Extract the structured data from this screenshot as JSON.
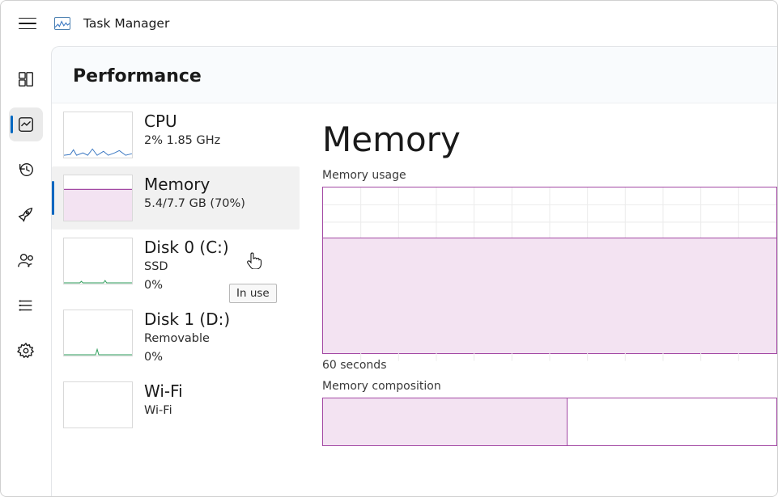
{
  "app": {
    "title": "Task Manager"
  },
  "page": {
    "title": "Performance"
  },
  "categories": {
    "cpu": {
      "title": "CPU",
      "sub1": "2%  1.85 GHz"
    },
    "memory": {
      "title": "Memory",
      "sub1": "5.4/7.7 GB (70%)"
    },
    "disk0": {
      "title": "Disk 0 (C:)",
      "sub1": "SSD",
      "sub2": "0%"
    },
    "disk1": {
      "title": "Disk 1 (D:)",
      "sub1": "Removable",
      "sub2": "0%"
    },
    "wifi": {
      "title": "Wi-Fi",
      "sub1": "Wi-Fi"
    }
  },
  "tooltip": "In use",
  "detail": {
    "title": "Memory",
    "usage_label": "Memory usage",
    "x_axis": "60 seconds",
    "composition_label": "Memory composition"
  },
  "colors": {
    "accent": "#0067c0",
    "mem": "#a349a4",
    "mem_fill": "#f3e3f2",
    "cpu": "#3a77c2"
  },
  "chart_data": {
    "usage": {
      "type": "area",
      "title": "Memory usage",
      "xlabel": "60 seconds",
      "ylabel": "",
      "ylim": [
        0,
        7.7
      ],
      "x_range_seconds": 60,
      "series": [
        {
          "name": "In use (GB)",
          "values": [
            5.4,
            5.4,
            5.4,
            5.4,
            5.4,
            5.4,
            5.4,
            5.4,
            5.4,
            5.4,
            5.4,
            5.4
          ]
        }
      ],
      "percent_used": 70,
      "total_gb": 7.7,
      "used_gb": 5.4
    },
    "composition": {
      "type": "bar",
      "orientation": "horizontal",
      "title": "Memory composition",
      "categories": [
        "In use"
      ],
      "values": [
        5.4
      ],
      "total": 7.7
    },
    "sidebar_thumbnails": {
      "cpu": {
        "type": "line",
        "percent": 2
      },
      "memory": {
        "type": "area",
        "percent": 70
      },
      "disk0": {
        "type": "line",
        "percent": 0
      },
      "disk1": {
        "type": "line",
        "percent": 0
      }
    }
  }
}
